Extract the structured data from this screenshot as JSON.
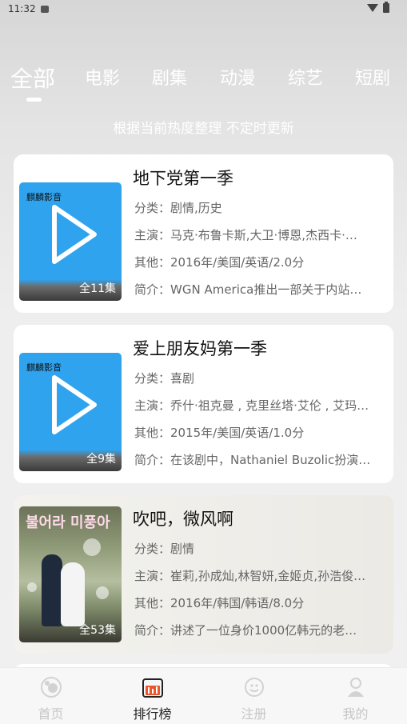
{
  "status": {
    "time": "11:32"
  },
  "tabs": [
    {
      "label": "全部"
    },
    {
      "label": "电影"
    },
    {
      "label": "剧集"
    },
    {
      "label": "动漫"
    },
    {
      "label": "综艺"
    },
    {
      "label": "短剧"
    }
  ],
  "subtitle": "根据当前热度整理 不定时更新",
  "brand": "麒麟影音",
  "cards": [
    {
      "title": "地下党第一季",
      "episodes": "全11集",
      "category": "分类：剧情,历史",
      "cast": "主演：马克·布鲁卡斯,大卫·博恩,杰西卡·…",
      "other": "其他：2016年/美国/英语/2.0分",
      "intro": "简介：WGN America推出一部关于内站…"
    },
    {
      "title": "爱上朋友妈第一季",
      "episodes": "全9集",
      "category": "分类：喜剧",
      "cast": "主演：乔什·祖克曼 , 克里丝塔·艾伦 , 艾玛…",
      "other": "其他：2015年/美国/英语/1.0分",
      "intro": "简介：在该剧中，Nathaniel Buzolic扮演…"
    },
    {
      "title": "吹吧，微风啊",
      "episodes": "全53集",
      "poster_text": "불어라 미풍아",
      "category": "分类：剧情",
      "cast": "主演：崔莉,孙成灿,林智妍,金姬贞,孙浩俊…",
      "other": "其他：2016年/韩国/韩语/8.0分",
      "intro": "简介：讲述了一位身价1000亿韩元的老…"
    }
  ],
  "nav": [
    {
      "label": "首页",
      "icon": "home-icon"
    },
    {
      "label": "排行榜",
      "icon": "ranking-icon"
    },
    {
      "label": "注册",
      "icon": "register-icon"
    },
    {
      "label": "我的",
      "icon": "profile-icon"
    }
  ],
  "colors": {
    "poster_blue": "#2fa3ee",
    "ranking_orange": "#e8582c",
    "active_text": "#222222",
    "inactive_text": "#c6c6c6"
  }
}
